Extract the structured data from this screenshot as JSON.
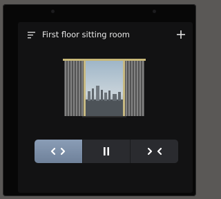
{
  "device": {
    "room_title": "First floor sitting room"
  },
  "icons": {
    "menu": "menu-icon",
    "add": "plus-icon",
    "open": "curtain-open-icon",
    "pause": "pause-icon",
    "close": "curtain-close-icon"
  },
  "controls": {
    "active": "open"
  },
  "colors": {
    "active_button": "#7a8ca6",
    "screen_bg": "#121213",
    "curtain_rod": "#c8b878"
  }
}
